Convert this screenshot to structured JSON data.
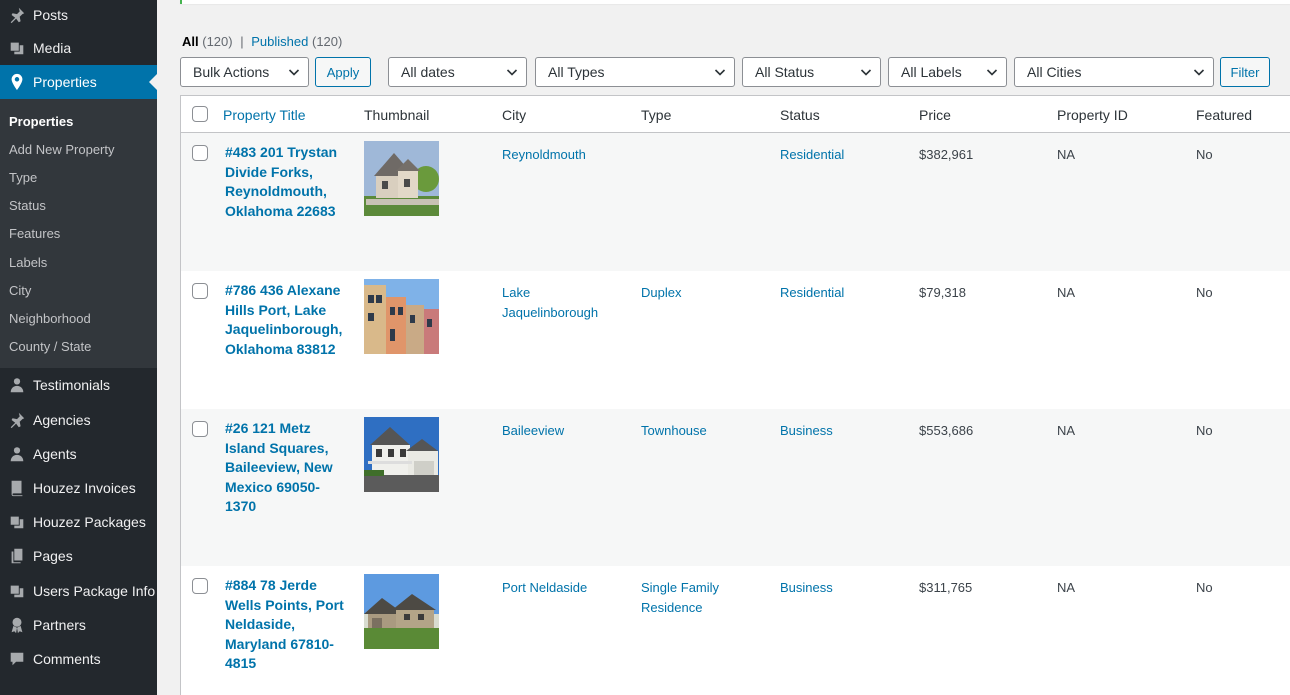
{
  "sidebar": {
    "top_items": [
      {
        "label": "Posts",
        "icon": "pin-icon"
      },
      {
        "label": "Media",
        "icon": "media-icon"
      },
      {
        "label": "Properties",
        "icon": "location-pin-icon"
      }
    ],
    "submenu": [
      "Properties",
      "Add New Property",
      "Type",
      "Status",
      "Features",
      "Labels",
      "City",
      "Neighborhood",
      "County / State"
    ],
    "bottom_items": [
      {
        "label": "Testimonials",
        "icon": "person-icon"
      },
      {
        "label": "Agencies",
        "icon": "pin-icon"
      },
      {
        "label": "Agents",
        "icon": "person-icon"
      },
      {
        "label": "Houzez Invoices",
        "icon": "book-icon"
      },
      {
        "label": "Houzez Packages",
        "icon": "media-icon"
      },
      {
        "label": "Pages",
        "icon": "pages-icon"
      },
      {
        "label": "Users Package Info",
        "icon": "media-icon"
      },
      {
        "label": "Partners",
        "icon": "award-icon"
      },
      {
        "label": "Comments",
        "icon": "comment-icon"
      }
    ]
  },
  "filters": {
    "all_label": "All",
    "all_count": "(120)",
    "separator": "|",
    "published_label": "Published",
    "published_count": "(120)",
    "bulk_actions": "Bulk Actions",
    "apply": "Apply",
    "dates": "All dates",
    "types": "All Types",
    "status": "All Status",
    "labels": "All Labels",
    "cities": "All Cities",
    "filter": "Filter"
  },
  "table": {
    "columns": [
      "Property Title",
      "Thumbnail",
      "City",
      "Type",
      "Status",
      "Price",
      "Property ID",
      "Featured"
    ],
    "rows": [
      {
        "title": "#483 201 Trystan Divide Forks, Reynoldmouth, Oklahoma 22683",
        "city": "Reynoldmouth",
        "type": "",
        "status": "Residential",
        "price": "$382,961",
        "property_id": "NA",
        "featured": "No"
      },
      {
        "title": "#786 436 Alexane Hills Port, Lake Jaquelinborough, Oklahoma 83812",
        "city": "Lake Jaquelinborough",
        "type": "Duplex",
        "status": "Residential",
        "price": "$79,318",
        "property_id": "NA",
        "featured": "No"
      },
      {
        "title": "#26 121 Metz Island Squares, Baileeview, New Mexico 69050-1370",
        "city": "Baileeview",
        "type": "Townhouse",
        "status": "Business",
        "price": "$553,686",
        "property_id": "NA",
        "featured": "No"
      },
      {
        "title": "#884 78 Jerde Wells Points, Port Neldaside, Maryland 67810-4815",
        "city": "Port Neldaside",
        "type": "Single Family Residence",
        "status": "Business",
        "price": "$311,765",
        "property_id": "NA",
        "featured": "No"
      }
    ]
  },
  "colors": {
    "accent": "#0073aa",
    "sidebar_bg": "#23282d",
    "submenu_bg": "#32373c"
  }
}
